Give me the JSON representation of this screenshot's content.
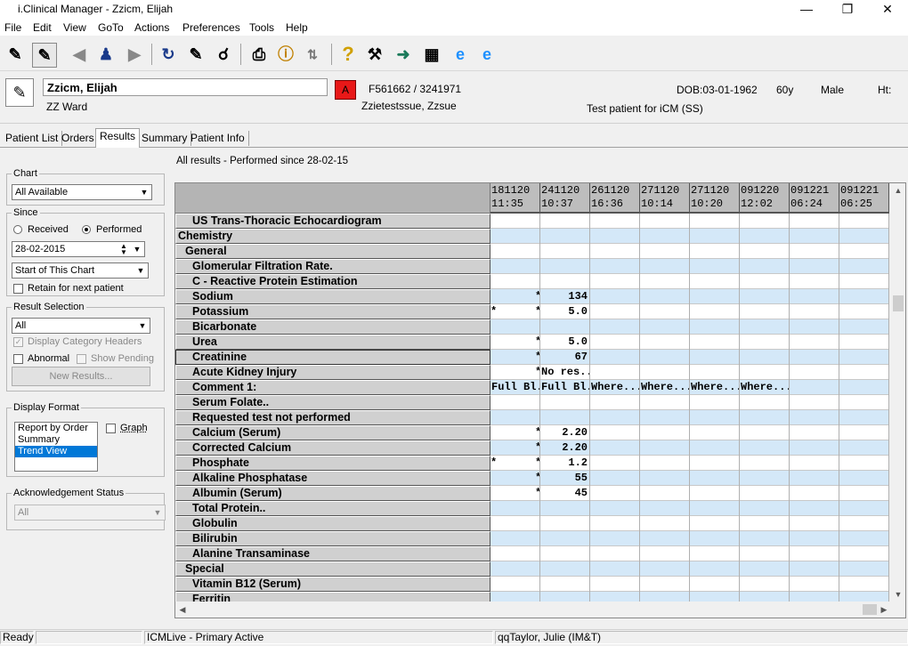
{
  "window": {
    "title": "i.Clinical Manager - Zzicm, Elijah"
  },
  "menu": [
    "File",
    "Edit",
    "View",
    "GoTo",
    "Actions",
    "Preferences",
    "Tools",
    "Help"
  ],
  "toolbar_icons": [
    "patient-icon",
    "patient-select-icon",
    "back-arrow-icon",
    "family-icon",
    "forward-arrow-icon",
    "refresh-icon",
    "edit-icon",
    "find-icon",
    "print-icon",
    "info-icon",
    "sort-icon",
    "help-icon",
    "toolkit-icon",
    "exit-icon",
    "calculator-icon",
    "ie-icon",
    "ie-alt-icon"
  ],
  "patient": {
    "name": "Zzicm, Elijah",
    "ward": "ZZ Ward",
    "alert": "A",
    "ids": "F561662 / 3241971",
    "consultant": "Zzietestssue, Zzsue",
    "dob": "DOB:03-01-1962",
    "age": "60y",
    "sex": "Male",
    "ht": "Ht:",
    "note": "Test patient for iCM (SS)"
  },
  "tabs": [
    "Patient List",
    "Orders",
    "Results",
    "Summary",
    "Patient Info"
  ],
  "active_tab": "Results",
  "results_header": "All results - Performed since 28-02-15",
  "left": {
    "chart": {
      "label": "Chart",
      "value": "All Available"
    },
    "since": {
      "label": "Since",
      "received": "Received",
      "performed": "Performed",
      "date": "28-02-2015",
      "range": "Start of This Chart",
      "retain": "Retain for next patient"
    },
    "result_selection": {
      "label": "Result Selection",
      "value": "All",
      "display_headers": "Display Category Headers",
      "abnormal": "Abnormal",
      "show_pending": "Show Pending",
      "new_results": "New Results..."
    },
    "display_format": {
      "label": "Display Format",
      "options": [
        "Report by Order",
        "Summary",
        "Trend View"
      ],
      "selected": "Trend View",
      "graph": "Graph"
    },
    "ack": {
      "label": "Acknowledgement Status",
      "value": "All"
    }
  },
  "grid": {
    "columns": [
      {
        "date": "181120",
        "time": "11:35"
      },
      {
        "date": "241120",
        "time": "10:37"
      },
      {
        "date": "261120",
        "time": "16:36"
      },
      {
        "date": "271120",
        "time": "10:14"
      },
      {
        "date": "271120",
        "time": "10:20"
      },
      {
        "date": "091220",
        "time": "12:02"
      },
      {
        "date": "091221",
        "time": "06:24"
      },
      {
        "date": "091221",
        "time": "06:25"
      }
    ],
    "rows": [
      {
        "label": "US Trans-Thoracic Echocardiogram",
        "indent": 2,
        "bg": "white",
        "cells": {}
      },
      {
        "label": "Chemistry",
        "indent": 0,
        "bg": "blue",
        "cells": {}
      },
      {
        "label": "General",
        "indent": 1,
        "bg": "white",
        "cells": {}
      },
      {
        "label": "Glomerular Filtration Rate.",
        "indent": 2,
        "bg": "blue",
        "cells": {}
      },
      {
        "label": "C - Reactive Protein Estimation",
        "indent": 2,
        "bg": "white",
        "cells": {}
      },
      {
        "label": "Sodium",
        "indent": 2,
        "bg": "blue",
        "cells": {
          "c1": {
            "star_r": "*"
          },
          "c2": {
            "value": "134"
          }
        }
      },
      {
        "label": "Potassium",
        "indent": 2,
        "bg": "white",
        "cells": {
          "c1": {
            "star_l": "*",
            "star_r": "*"
          },
          "c2": {
            "value": "5.0"
          }
        }
      },
      {
        "label": "Bicarbonate",
        "indent": 2,
        "bg": "blue",
        "cells": {}
      },
      {
        "label": "Urea",
        "indent": 2,
        "bg": "white",
        "cells": {
          "c1": {
            "star_r": "*"
          },
          "c2": {
            "value": "5.0"
          }
        }
      },
      {
        "label": "Creatinine",
        "indent": 2,
        "bg": "blue",
        "cells": {
          "c1": {
            "star_r": "*"
          },
          "c2": {
            "value": "67"
          }
        },
        "selected": true
      },
      {
        "label": "Acute Kidney Injury",
        "indent": 2,
        "bg": "white",
        "cells": {
          "c1": {
            "star_r": "*"
          },
          "c2": {
            "text": "No res..."
          }
        }
      },
      {
        "label": "Comment 1:",
        "indent": 2,
        "bg": "blue",
        "cells": {
          "c1": {
            "text": "Full Bl..."
          },
          "c2": {
            "text": "Full Bl..."
          },
          "c3": {
            "text": "Where..."
          },
          "c4": {
            "text": "Where..."
          },
          "c5": {
            "text": "Where..."
          },
          "c6": {
            "text": "Where..."
          }
        }
      },
      {
        "label": "Serum Folate..",
        "indent": 2,
        "bg": "white",
        "cells": {}
      },
      {
        "label": "Requested test not performed",
        "indent": 2,
        "bg": "blue",
        "cells": {}
      },
      {
        "label": "Calcium (Serum)",
        "indent": 2,
        "bg": "white",
        "cells": {
          "c1": {
            "star_r": "*"
          },
          "c2": {
            "value": "2.20"
          }
        }
      },
      {
        "label": "Corrected Calcium",
        "indent": 2,
        "bg": "blue",
        "cells": {
          "c1": {
            "star_r": "*"
          },
          "c2": {
            "value": "2.20"
          }
        }
      },
      {
        "label": "Phosphate",
        "indent": 2,
        "bg": "white",
        "cells": {
          "c1": {
            "star_l": "*",
            "star_r": "*"
          },
          "c2": {
            "value": "1.2"
          }
        }
      },
      {
        "label": "Alkaline Phosphatase",
        "indent": 2,
        "bg": "blue",
        "cells": {
          "c1": {
            "star_r": "*"
          },
          "c2": {
            "value": "55"
          }
        }
      },
      {
        "label": "Albumin (Serum)",
        "indent": 2,
        "bg": "white",
        "cells": {
          "c1": {
            "star_r": "*"
          },
          "c2": {
            "value": "45"
          }
        }
      },
      {
        "label": "Total Protein..",
        "indent": 2,
        "bg": "blue",
        "cells": {}
      },
      {
        "label": "Globulin",
        "indent": 2,
        "bg": "white",
        "cells": {}
      },
      {
        "label": "Bilirubin",
        "indent": 2,
        "bg": "blue",
        "cells": {}
      },
      {
        "label": "Alanine Transaminase",
        "indent": 2,
        "bg": "white",
        "cells": {}
      },
      {
        "label": "Special",
        "indent": 1,
        "bg": "blue",
        "cells": {}
      },
      {
        "label": "Vitamin B12 (Serum)",
        "indent": 2,
        "bg": "white",
        "cells": {}
      },
      {
        "label": "Ferritin",
        "indent": 2,
        "bg": "blue",
        "cells": {}
      }
    ]
  },
  "status": {
    "state": "Ready",
    "server": "ICMLive - Primary Active",
    "user": "qqTaylor, Julie (IM&T)"
  },
  "colors": {
    "selection": "#0078d7",
    "row_blue": "#d4e8f8",
    "alert_red": "#e81818"
  }
}
